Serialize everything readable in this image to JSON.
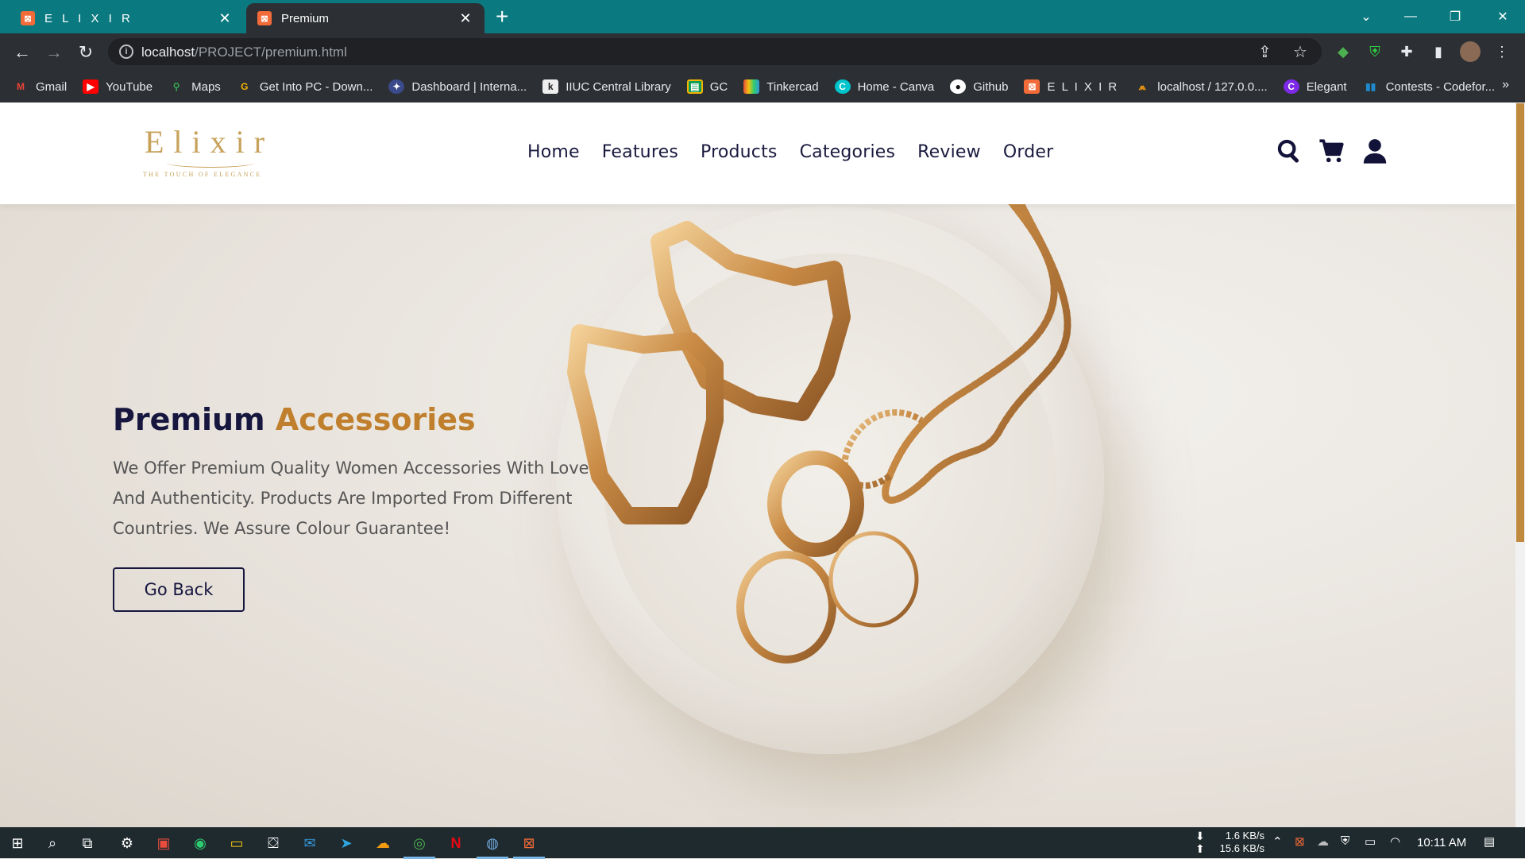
{
  "browser": {
    "tabs": [
      {
        "title": "E L I X I R",
        "icon": "xampp-icon",
        "active": false
      },
      {
        "title": "Premium",
        "icon": "xampp-icon",
        "active": true
      }
    ],
    "url_host": "localhost",
    "url_path": "/PROJECT/premium.html",
    "bookmarks": [
      {
        "label": "Gmail",
        "icon": "gmail-icon",
        "color": "#ea4335"
      },
      {
        "label": "YouTube",
        "icon": "youtube-icon",
        "color": "#ff0000"
      },
      {
        "label": "Maps",
        "icon": "maps-icon",
        "color": "#34a853"
      },
      {
        "label": "Get Into PC - Down...",
        "icon": "getintopc-icon",
        "color": "#f4b400"
      },
      {
        "label": "Dashboard | Interna...",
        "icon": "iiuc-icon",
        "color": "#3b4a8a"
      },
      {
        "label": "IIUC Central Library",
        "icon": "koha-icon",
        "color": "#5a5a5a"
      },
      {
        "label": "GC",
        "icon": "classroom-icon",
        "color": "#0f9d58"
      },
      {
        "label": "Tinkercad",
        "icon": "tinkercad-icon",
        "color": "#1477d1"
      },
      {
        "label": "Home - Canva",
        "icon": "canva-icon",
        "color": "#00c4cc"
      },
      {
        "label": "Github",
        "icon": "github-icon",
        "color": "#333333"
      },
      {
        "label": "E L I X I R",
        "icon": "xampp-icon",
        "color": "#f26b38"
      },
      {
        "label": "localhost / 127.0.0....",
        "icon": "phpmyadmin-icon",
        "color": "#f89c0e"
      },
      {
        "label": "Elegant",
        "icon": "canva-icon",
        "color": "#7d2ae8"
      },
      {
        "label": "Contests - Codefor...",
        "icon": "codeforces-icon",
        "color": "#1f8acb"
      }
    ]
  },
  "site": {
    "logo_word": "Elixir",
    "logo_tagline": "THE TOUCH OF ELEGANCE",
    "nav": [
      "Home",
      "Features",
      "Products",
      "Categories",
      "Review",
      "Order"
    ],
    "hero": {
      "title_main": "Premium",
      "title_accent": "Accessories",
      "description": "We Offer Premium Quality Women Accessories With Love And Authenticity. Products Are Imported From Different Countries. We Assure Colour Guarantee!",
      "button_label": "Go Back"
    },
    "colors": {
      "navy": "#16163f",
      "gold": "#c07f2c"
    }
  },
  "taskbar": {
    "net_down": "1.6 KB/s",
    "net_up": "15.6 KB/s",
    "time": "10:11 AM"
  }
}
